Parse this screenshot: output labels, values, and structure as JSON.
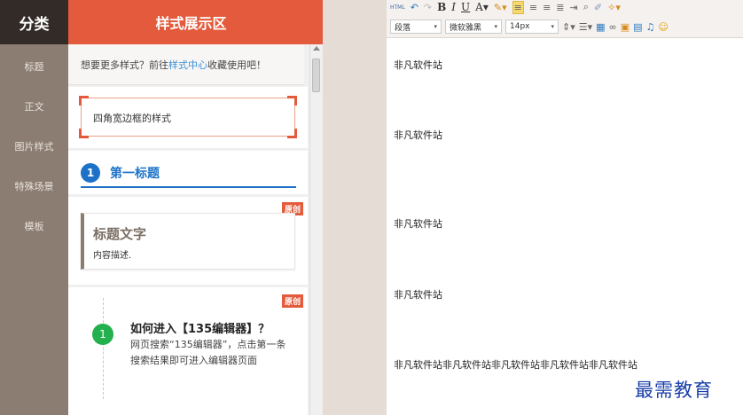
{
  "category": {
    "header": "分类",
    "items": [
      "标题",
      "正文",
      "图片样式",
      "特殊场景",
      "模板"
    ]
  },
  "style_panel": {
    "header": "样式展示区",
    "tip_prefix": "想要更多样式？前往",
    "tip_link": "样式中心",
    "tip_suffix": "收藏使用吧！",
    "corner_box_text": "四角宽边框的样式",
    "title1_number": "1",
    "title1_text": "第一标题",
    "badge_label": "原创",
    "heading_title": "标题文字",
    "heading_desc": "内容描述.",
    "q_number": "1",
    "q_title": "如何进入【135编辑器】？",
    "q_body": "网页搜索“135编辑器”，点击第一条搜索结果即可进入编辑器页面"
  },
  "toolbar": {
    "html_label": "HTML",
    "paragraph_select": "段落",
    "font_select": "微软雅黑",
    "size_select": "14px"
  },
  "editor": {
    "lines": [
      "非凡软件站",
      "非凡软件站",
      "非凡软件站",
      "非凡软件站",
      "非凡软件站非凡软件站非凡软件站非凡软件站非凡软件站"
    ]
  },
  "watermark": "最需教育",
  "colors": {
    "accent": "#e35b3c",
    "category_bg": "#8b7d72",
    "title_blue": "#1d72c7",
    "step_green": "#22b14c"
  }
}
